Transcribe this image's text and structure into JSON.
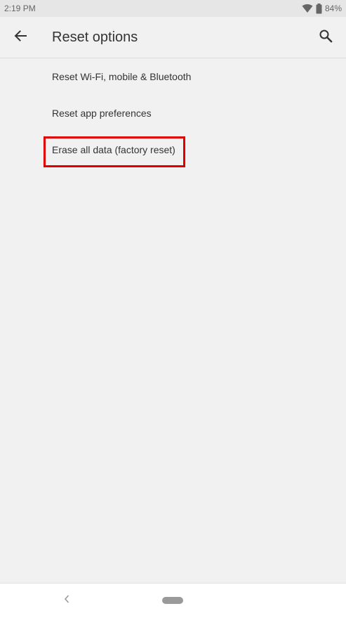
{
  "status_bar": {
    "time": "2:19 PM",
    "battery": "84%"
  },
  "app_bar": {
    "title": "Reset options"
  },
  "options": [
    {
      "label": "Reset Wi-Fi, mobile & Bluetooth"
    },
    {
      "label": "Reset app preferences"
    },
    {
      "label": "Erase all data (factory reset)"
    }
  ],
  "icons": {
    "back": "arrow-back-icon",
    "search": "search-icon",
    "wifi": "wifi-icon",
    "battery": "battery-icon",
    "nav_back": "nav-back-icon",
    "nav_home": "nav-home-pill"
  },
  "colors": {
    "highlight": "#e00000",
    "background": "#f1f1f1",
    "text": "#333333"
  }
}
